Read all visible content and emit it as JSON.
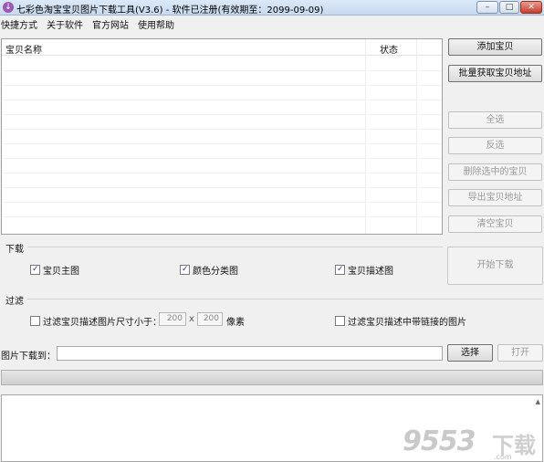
{
  "window": {
    "title": "七彩色淘宝宝贝图片下载工具(V3.6) - 软件已注册(有效期至：2099-09-09)",
    "minimize_label": "–",
    "maximize_label": "□",
    "close_label": "✕"
  },
  "menu": [
    "快捷方式",
    "关于软件",
    "官方网站",
    "使用帮助"
  ],
  "list": {
    "columns": [
      "宝贝名称",
      "状态"
    ]
  },
  "buttons": {
    "add": "添加宝贝",
    "batch": "批量获取宝贝地址",
    "select_all": "全选",
    "invert": "反选",
    "delete_selected": "删除选中的宝贝",
    "export": "导出宝贝地址",
    "clear": "清空宝贝",
    "start": "开始下载",
    "choose": "选择",
    "open": "打开"
  },
  "download": {
    "label": "下载",
    "options": [
      {
        "label": "宝贝主图",
        "checked": true
      },
      {
        "label": "颜色分类图",
        "checked": true
      },
      {
        "label": "宝贝描述图",
        "checked": true
      }
    ]
  },
  "filter": {
    "label": "过滤",
    "size_label": "过滤宝贝描述图片尺寸小于：",
    "width": "200",
    "times": "x",
    "height": "200",
    "unit": "像素",
    "link_label": "过滤宝贝描述中带链接的图片"
  },
  "save_to": {
    "label": "图片下载到：",
    "value": ""
  },
  "progress": 0,
  "watermark": {
    "number": "9553",
    "suffix": "下载",
    "domain": ".com"
  }
}
